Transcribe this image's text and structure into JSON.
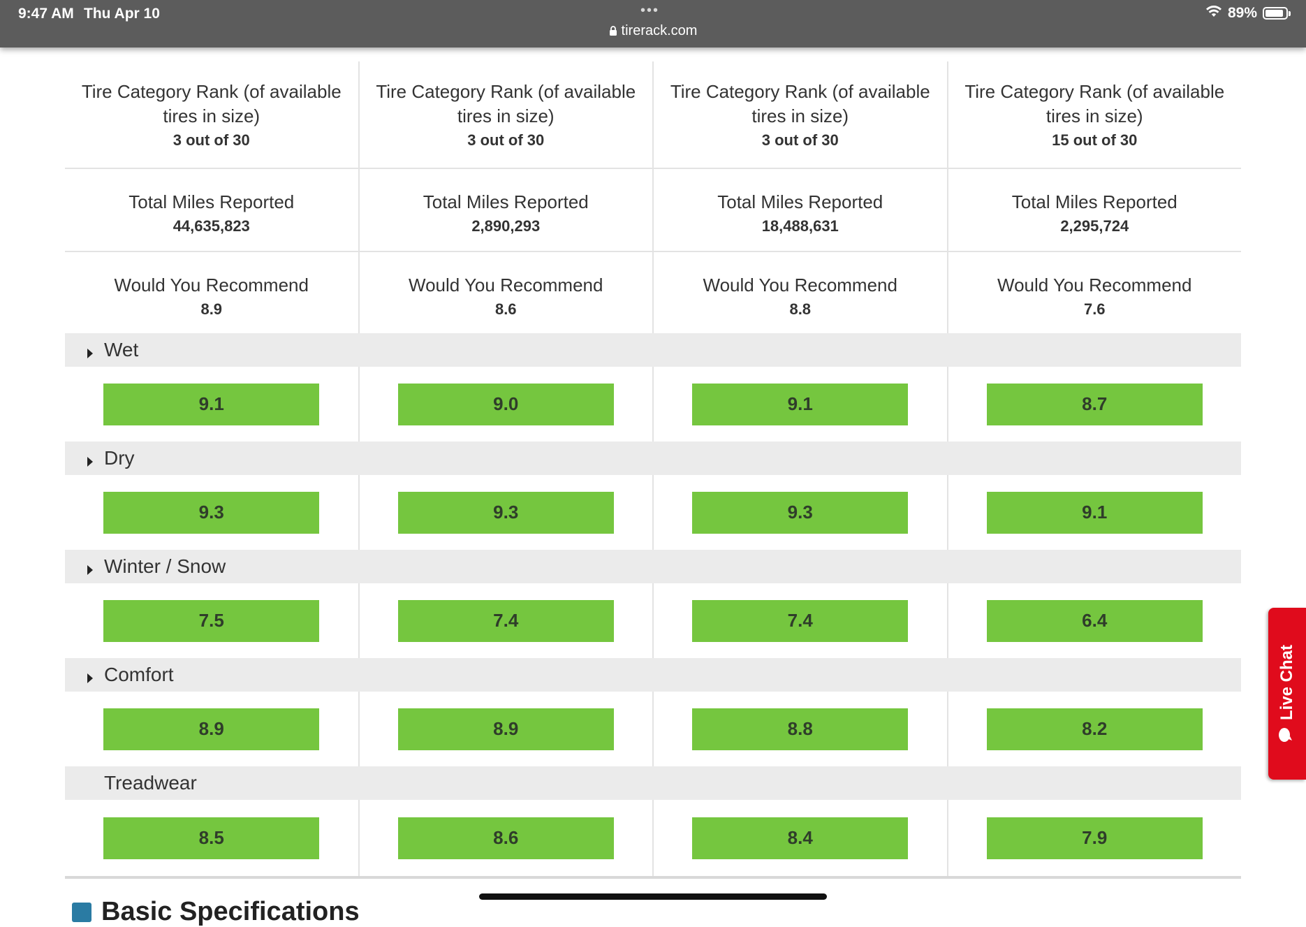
{
  "status_bar": {
    "time": "9:47 AM",
    "date": "Thu Apr 10",
    "battery": "89%",
    "battery_level": 0.89,
    "url": "tirerack.com"
  },
  "columns": [
    {
      "rank_label": "Tire Category Rank (of available tires in size)",
      "rank_value": "3 out of 30",
      "miles_label": "Total Miles Reported",
      "miles_value": "44,635,823",
      "recommend_label": "Would You Recommend",
      "recommend_value": "8.9"
    },
    {
      "rank_label": "Tire Category Rank (of available tires in size)",
      "rank_value": "3 out of 30",
      "miles_label": "Total Miles Reported",
      "miles_value": "2,890,293",
      "recommend_label": "Would You Recommend",
      "recommend_value": "8.6"
    },
    {
      "rank_label": "Tire Category Rank (of available tires in size)",
      "rank_value": "3 out of 30",
      "miles_label": "Total Miles Reported",
      "miles_value": "18,488,631",
      "recommend_label": "Would You Recommend",
      "recommend_value": "8.8"
    },
    {
      "rank_label": "Tire Category Rank (of available tires in size)",
      "rank_value": "15 out of 30",
      "miles_label": "Total Miles Reported",
      "miles_value": "2,295,724",
      "recommend_label": "Would You Recommend",
      "recommend_value": "7.6"
    }
  ],
  "categories": [
    {
      "label": "Wet",
      "expandable": true,
      "scores": [
        "9.1",
        "9.0",
        "9.1",
        "8.7"
      ]
    },
    {
      "label": "Dry",
      "expandable": true,
      "scores": [
        "9.3",
        "9.3",
        "9.3",
        "9.1"
      ]
    },
    {
      "label": "Winter / Snow",
      "expandable": true,
      "scores": [
        "7.5",
        "7.4",
        "7.4",
        "6.4"
      ]
    },
    {
      "label": "Comfort",
      "expandable": true,
      "scores": [
        "8.9",
        "8.9",
        "8.8",
        "8.2"
      ]
    },
    {
      "label": "Treadwear",
      "expandable": false,
      "scores": [
        "8.5",
        "8.6",
        "8.4",
        "7.9"
      ]
    }
  ],
  "section_heading": "Basic Specifications",
  "live_chat": {
    "label": "Live Chat"
  },
  "colors": {
    "score_bar": "#75c63f",
    "live_chat": "#e00b1c",
    "header_bg": "#5c5c5c",
    "section_icon": "#2a7ba3"
  }
}
